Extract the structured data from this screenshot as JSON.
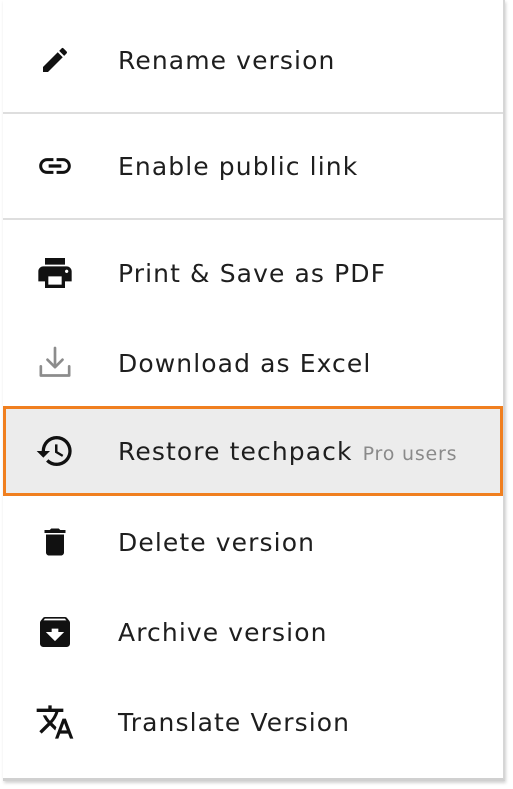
{
  "menu": {
    "items": [
      {
        "label": "Rename version",
        "icon": "pencil-icon"
      },
      {
        "label": "Enable public link",
        "icon": "link-icon"
      },
      {
        "label": "Print & Save as PDF",
        "icon": "print-icon"
      },
      {
        "label": "Download as Excel",
        "icon": "download-icon"
      },
      {
        "label": "Restore techpack",
        "hint": "Pro users",
        "icon": "restore-history-icon"
      },
      {
        "label": "Delete version",
        "icon": "trash-icon"
      },
      {
        "label": "Archive version",
        "icon": "archive-icon"
      },
      {
        "label": "Translate Version",
        "icon": "translate-icon"
      }
    ]
  },
  "colors": {
    "highlight_border": "#f07f1f",
    "highlight_background": "#ececec",
    "text": "#1e1e1e",
    "hint_text": "#8a8a8a",
    "icon_muted": "#8c8c8c"
  }
}
